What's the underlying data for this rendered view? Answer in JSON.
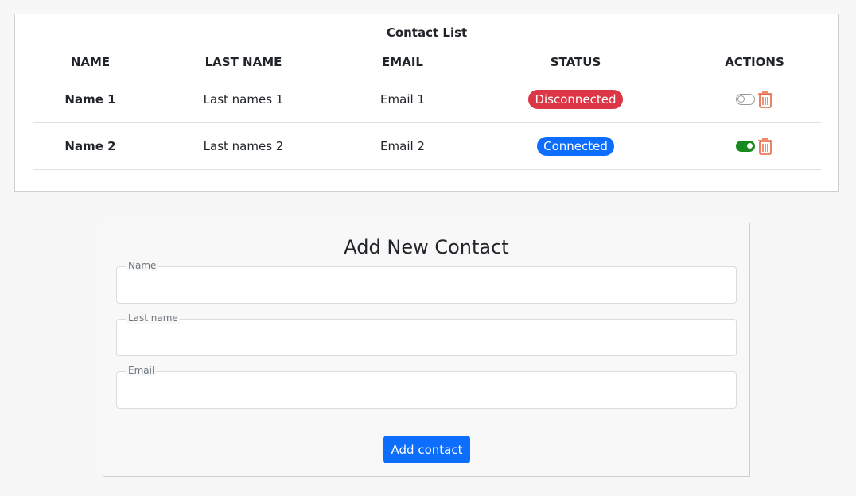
{
  "contact_list": {
    "title": "Contact List",
    "headers": [
      "NAME",
      "LAST NAME",
      "EMAIL",
      "STATUS",
      "ACTIONS"
    ],
    "rows": [
      {
        "name": "Name 1",
        "last_name": "Last names 1",
        "email": "Email 1",
        "status": "Disconnected",
        "status_color": "#dc3545",
        "toggle_on": false
      },
      {
        "name": "Name 2",
        "last_name": "Last names 2",
        "email": "Email 2",
        "status": "Connected",
        "status_color": "#0d6efd",
        "toggle_on": true
      }
    ]
  },
  "form": {
    "title": "Add New Contact",
    "fields": [
      {
        "label": "Name",
        "value": ""
      },
      {
        "label": "Last name",
        "value": ""
      },
      {
        "label": "Email",
        "value": ""
      }
    ],
    "submit_label": "Add contact"
  },
  "colors": {
    "accent": "#0d6efd",
    "danger": "#dc3545",
    "toggle_on": "#198a1e",
    "delete_icon": "#e8623f"
  }
}
